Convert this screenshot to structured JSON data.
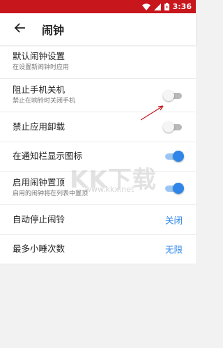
{
  "status_bar": {
    "time": "3:36",
    "icons": [
      "wifi-icon",
      "cellular-signal-icon",
      "battery-icon"
    ],
    "background": "#c8161d"
  },
  "app_bar": {
    "title": "闹钟",
    "back_icon": "arrow-left-icon"
  },
  "settings": [
    {
      "title": "默认闹钟设置",
      "subtitle": "在设置新闹钟时应用"
    },
    {
      "title": "阻止手机关机",
      "subtitle": "禁止在响铃时关闭手机",
      "toggle": false
    },
    {
      "title": "禁止应用卸载",
      "toggle": false
    },
    {
      "title": "在通知栏显示图标",
      "toggle": true
    },
    {
      "title": "启用闹钟置顶",
      "subtitle": "启用的闹钟将在列表中置顶",
      "toggle": true
    },
    {
      "title": "自动停止闹铃",
      "value": "关闭"
    },
    {
      "title": "最多小睡次数",
      "value": "无限"
    }
  ],
  "watermark": {
    "logo": "KK下载",
    "url": "www.kkx.net"
  },
  "colors": {
    "accent": "#2f86e8",
    "annotation_arrow": "#c8161d"
  }
}
